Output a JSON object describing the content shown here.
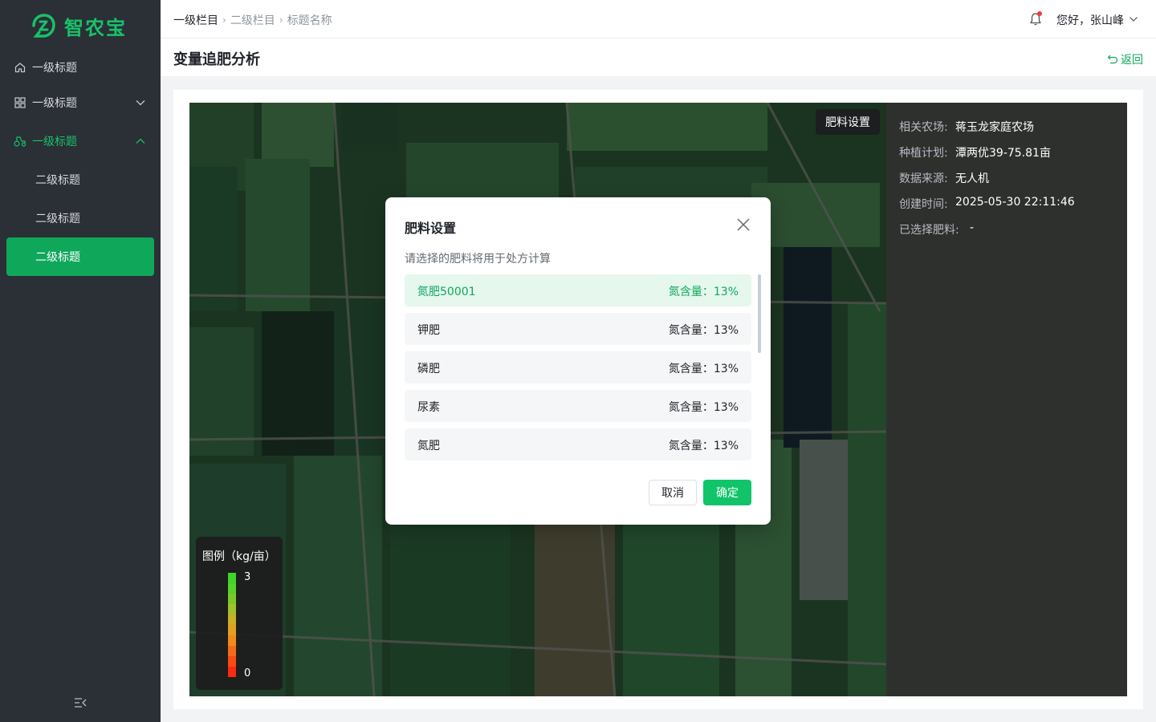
{
  "app": {
    "logo_text": "智农宝",
    "brand_color": "#17c26a"
  },
  "sidebar": {
    "items": [
      {
        "label": "一级标题",
        "icon": "home-icon"
      },
      {
        "label": "一级标题",
        "icon": "grid-icon"
      },
      {
        "label": "一级标题",
        "icon": "tractor-icon"
      }
    ],
    "subitems": [
      {
        "label": "二级标题"
      },
      {
        "label": "二级标题"
      },
      {
        "label": "二级标题"
      }
    ]
  },
  "header": {
    "breadcrumb": [
      "一级栏目",
      "二级栏目",
      "标题名称"
    ],
    "user_greeting": "您好，张山峰"
  },
  "page": {
    "title": "变量追肥分析",
    "back_label": "返回"
  },
  "map": {
    "fert_button": "肥料设置",
    "info": [
      {
        "key": "相关农场:",
        "value": "蒋玉龙家庭农场"
      },
      {
        "key": "种植计划:",
        "value": "潭两优39-75.81亩"
      },
      {
        "key": "数据来源:",
        "value": "无人机"
      },
      {
        "key": "创建时间:",
        "value": "2025-05-30 22:11:46"
      },
      {
        "key": "已选择肥料:",
        "value": "-"
      }
    ],
    "legend": {
      "title": "图例（kg/亩）",
      "max": "3",
      "min": "0"
    }
  },
  "modal": {
    "title": "肥料设置",
    "desc": "请选择的肥料将用于处方计算",
    "options": [
      {
        "name": "氮肥50001",
        "content": "氮含量：13%",
        "selected": true
      },
      {
        "name": "钾肥",
        "content": "氮含量：13%",
        "selected": false
      },
      {
        "name": "磷肥",
        "content": "氮含量：13%",
        "selected": false
      },
      {
        "name": "尿素",
        "content": "氮含量：13%",
        "selected": false
      },
      {
        "name": "氮肥",
        "content": "氮含量：13%",
        "selected": false
      }
    ],
    "cancel_label": "取消",
    "ok_label": "确定"
  }
}
